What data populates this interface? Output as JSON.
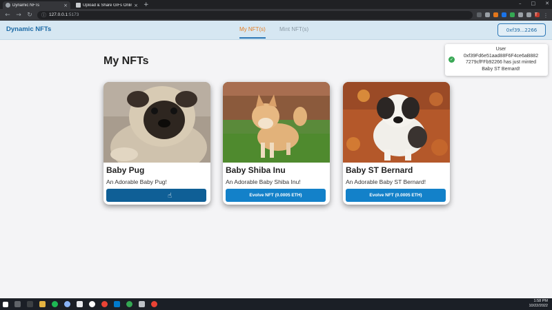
{
  "browser": {
    "tabs": [
      {
        "title": "Dynamic NFTs",
        "active": true
      },
      {
        "title": "Upload & Share GIFs Online | Gi...",
        "active": false
      }
    ],
    "new_tab": "+",
    "url_host": "127.0.0.1",
    "url_port": ":5173"
  },
  "header": {
    "brand": "Dynamic NFTs",
    "nav": [
      {
        "label": "My NFT(s)",
        "active": true
      },
      {
        "label": "Mint NFT(s)",
        "active": false
      }
    ],
    "wallet": "0xf39...2266"
  },
  "page": {
    "title": "My NFTs"
  },
  "toast": {
    "lines": [
      "User",
      "0xf39Fd6e51aad88F6F4ce6aB882",
      "7279cfFFb92266 has just minted",
      "Baby ST Bernard!"
    ]
  },
  "cards": [
    {
      "name": "Baby Pug",
      "description": "An Adorable Baby Pug!",
      "button": ""
    },
    {
      "name": "Baby Shiba Inu",
      "description": "An Adorable Baby Shiba Inu!",
      "button": "Evolve NFT (0.0005 ETH)"
    },
    {
      "name": "Baby ST Bernard",
      "description": "An Adorable Baby ST Bernard!",
      "button": "Evolve NFT (0.0005 ETH)"
    }
  ],
  "taskbar": {
    "time": "1:58 PM",
    "date": "10/22/2022"
  },
  "colors": {
    "accent": "#1381c9",
    "brand": "#1c6aa6",
    "active_nav": "#e67e22",
    "success": "#3aa856"
  }
}
